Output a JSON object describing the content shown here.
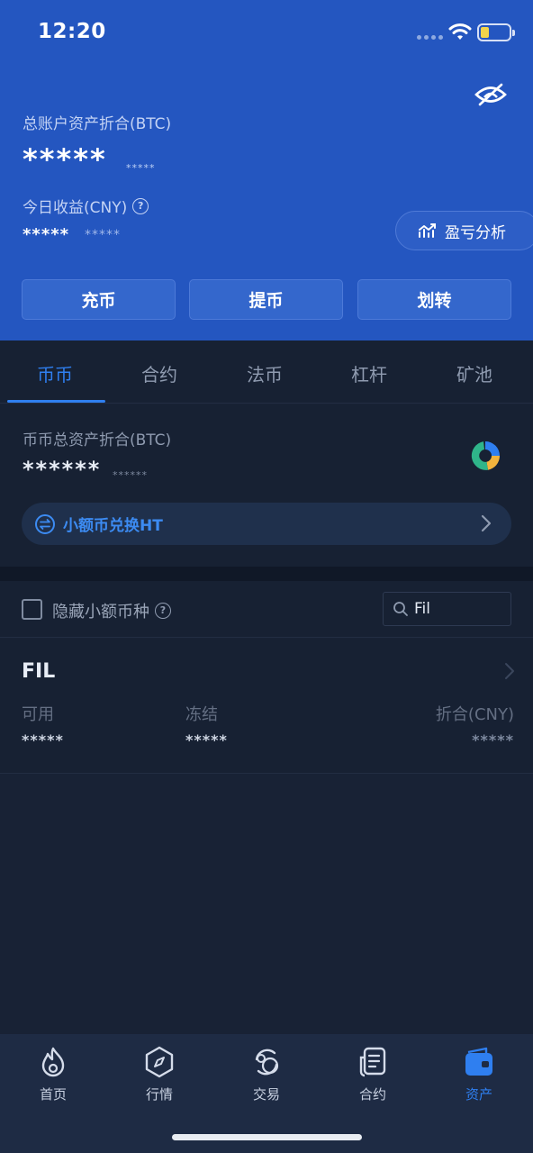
{
  "status_bar": {
    "time": "12:20"
  },
  "header": {
    "total_assets_label": "总账户资产折合(BTC)",
    "total_assets_masked": "*****",
    "total_assets_sub_masked": "*****",
    "today_profit_label": "今日收益(CNY)",
    "today_profit_masked": "*****",
    "today_profit_sub_masked": "*****",
    "pnl_analysis_label": "盈亏分析",
    "actions": {
      "deposit": "充币",
      "withdraw": "提币",
      "transfer": "划转"
    }
  },
  "tabs": {
    "items": [
      "币币",
      "合约",
      "法币",
      "杠杆",
      "矿池"
    ],
    "active": "币币"
  },
  "spot": {
    "total_label": "币币总资产折合(BTC)",
    "total_masked": "******",
    "total_sub_masked": "******",
    "small_exchange_label": "小额币兑换HT"
  },
  "filter": {
    "hide_small_label": "隐藏小额币种",
    "hide_small_checked": false,
    "search_value": "Fil"
  },
  "coin": {
    "name": "FIL",
    "available_label": "可用",
    "available_value": "*****",
    "frozen_label": "冻结",
    "frozen_value": "*****",
    "cny_label": "折合(CNY)",
    "cny_value": "*****"
  },
  "bottom_nav": {
    "items": [
      "首页",
      "行情",
      "交易",
      "合约",
      "资产"
    ],
    "active": "资产"
  },
  "colors": {
    "header_blue": "#2456c0",
    "accent_blue": "#2f7ff0",
    "background": "#182235"
  }
}
